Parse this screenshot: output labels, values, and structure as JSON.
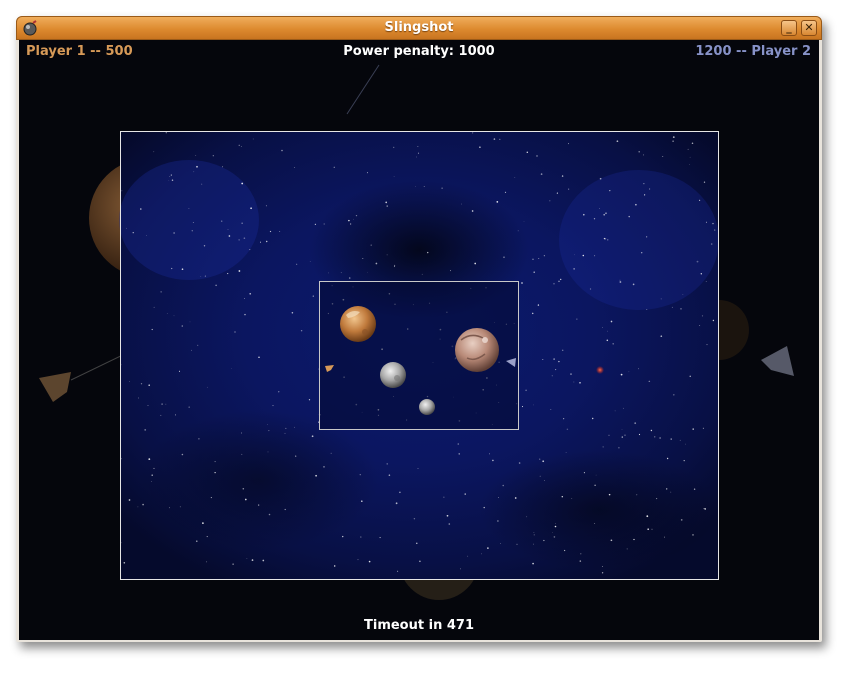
{
  "window": {
    "title": "Slingshot"
  },
  "titlebar_buttons": {
    "minimize": "_",
    "close": "✕"
  },
  "hud": {
    "player1": {
      "name": "Player 1",
      "score": "500",
      "text": "Player 1  --  500"
    },
    "player2": {
      "name": "Player 2",
      "score": "1200",
      "text": "1200  --  Player 2"
    },
    "power_penalty": "Power penalty: 1000",
    "timeout": "Timeout in 471"
  },
  "colors": {
    "titlebar": "#dd8a2f",
    "player1": "#d79a58",
    "player2": "#8792c8",
    "space_dark": "#05060c",
    "space_blue": "#0b1660"
  },
  "icons": {
    "app": "slingshot-app-icon",
    "minimize": "minimize-icon",
    "close": "close-icon"
  }
}
